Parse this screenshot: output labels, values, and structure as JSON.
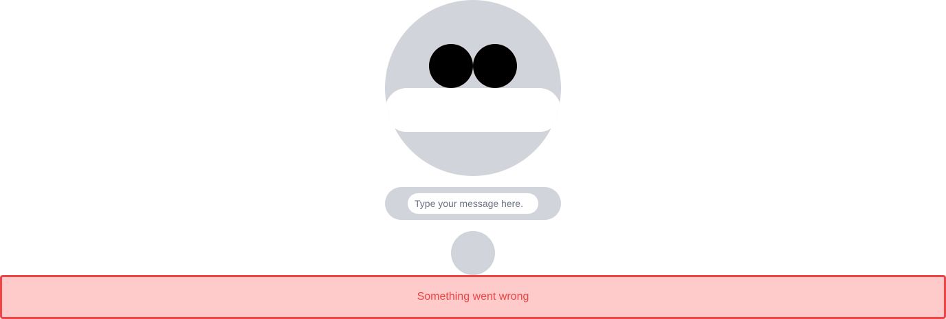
{
  "chat": {
    "input_placeholder": "Type your message here.",
    "input_value": ""
  },
  "error": {
    "message": "Something went wrong"
  },
  "colors": {
    "face": "#d1d5db",
    "eyes": "#000000",
    "mouth": "#ffffff",
    "error_background": "#fecaca",
    "error_border": "#ef4444",
    "error_text": "#ef4444"
  },
  "icons": {
    "avatar": "robot-face-icon",
    "send": "send-circle-icon"
  }
}
